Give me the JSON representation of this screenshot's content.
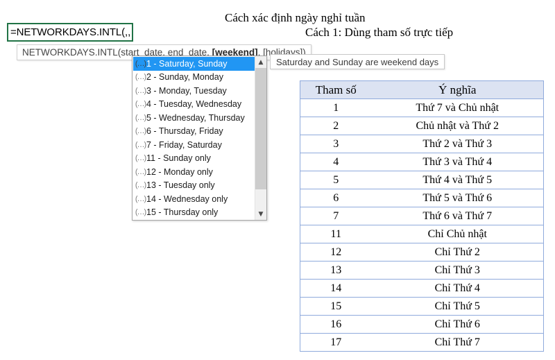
{
  "titles": {
    "main": "Cách xác định ngày nghỉ tuần",
    "sub": "Cách 1: Dùng tham số trực tiếp"
  },
  "cell_editor": {
    "formula": "=NETWORKDAYS.INTL(,,",
    "border_color": "#217346"
  },
  "function_tooltip": {
    "function_name": "NETWORKDAYS.INTL(",
    "args_before": "start_date, end_date, ",
    "active_arg": "[weekend]",
    "args_after": ", [holidays])"
  },
  "weekend_dropdown": {
    "selected_index": 0,
    "scroll_up_icon": "chevron-up-icon",
    "scroll_down_icon": "chevron-down-icon",
    "item_icon": "(…)",
    "items": [
      {
        "label": "1 - Saturday, Sunday"
      },
      {
        "label": "2 - Sunday, Monday"
      },
      {
        "label": "3 - Monday, Tuesday"
      },
      {
        "label": "4 - Tuesday, Wednesday"
      },
      {
        "label": "5 - Wednesday, Thursday"
      },
      {
        "label": "6 - Thursday, Friday"
      },
      {
        "label": "7 - Friday, Saturday"
      },
      {
        "label": "11 - Sunday only"
      },
      {
        "label": "12 - Monday only"
      },
      {
        "label": "13 - Tuesday only"
      },
      {
        "label": "14 - Wednesday only"
      },
      {
        "label": "15 - Thursday only"
      }
    ]
  },
  "description_tooltip": {
    "text": "Saturday and Sunday are weekend days"
  },
  "reference_table": {
    "header_bg": "#dce3f2",
    "border_color": "#8faadc",
    "columns": [
      "Tham số",
      "Ý nghĩa"
    ],
    "rows": [
      [
        "1",
        "Thứ 7 và Chủ nhật"
      ],
      [
        "2",
        "Chủ nhật và Thứ 2"
      ],
      [
        "3",
        "Thứ 2 và Thứ 3"
      ],
      [
        "4",
        "Thứ 3 và Thứ 4"
      ],
      [
        "5",
        "Thứ 4 và Thứ 5"
      ],
      [
        "6",
        "Thứ 5 và Thứ 6"
      ],
      [
        "7",
        "Thứ 6 và Thứ 7"
      ],
      [
        "11",
        "Chỉ Chủ nhật"
      ],
      [
        "12",
        "Chỉ Thứ 2"
      ],
      [
        "13",
        "Chỉ Thứ 3"
      ],
      [
        "14",
        "Chỉ Thứ 4"
      ],
      [
        "15",
        "Chỉ Thứ 5"
      ],
      [
        "16",
        "Chỉ Thứ 6"
      ],
      [
        "17",
        "Chỉ Thứ 7"
      ]
    ]
  }
}
